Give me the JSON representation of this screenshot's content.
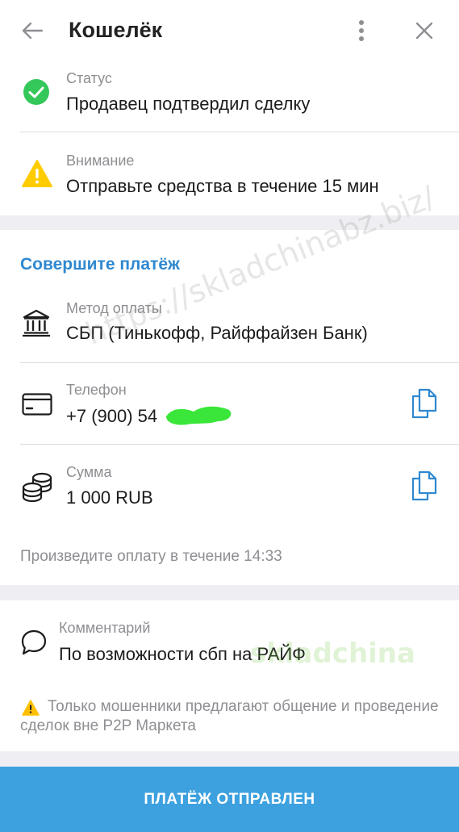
{
  "header": {
    "title": "Кошелёк"
  },
  "status": {
    "label": "Статус",
    "value": "Продавец подтвердил сделку"
  },
  "attention": {
    "label": "Внимание",
    "value": "Отправьте средства в течение 15 мин"
  },
  "payment": {
    "section_title": "Совершите платёж",
    "method": {
      "label": "Метод оплаты",
      "value": "СБП (Тинькофф, Райффайзен Банк)"
    },
    "phone": {
      "label": "Телефон",
      "value": "+7 (900) 54"
    },
    "amount": {
      "label": "Сумма",
      "value": "1 000 RUB"
    },
    "timer_hint": "Произведите оплату в течение 14:33"
  },
  "comment": {
    "label": "Комментарий",
    "value": "По возможности сбп на РАЙФ",
    "warning": "Только мошенники предлагают общение и проведение сделок вне P2P Маркета"
  },
  "actions": {
    "submit_label": "ПЛАТЁЖ ОТПРАВЛЕН"
  },
  "watermark": {
    "url": "https://skladchinabz.biz/",
    "logo": "skladchina"
  },
  "colors": {
    "accent": "#2f88d0",
    "button": "#3da1df",
    "success": "#34c759",
    "warning": "#ffcc00",
    "redaction": "#39e639"
  },
  "icons": {
    "back": "arrow-left-icon",
    "more": "more-vertical-icon",
    "close": "close-icon",
    "status": "check-circle-icon",
    "attention": "warning-triangle-icon",
    "method": "bank-icon",
    "phone": "credit-card-icon",
    "amount": "coins-icon",
    "copy": "copy-icon",
    "comment": "speech-bubble-icon"
  }
}
